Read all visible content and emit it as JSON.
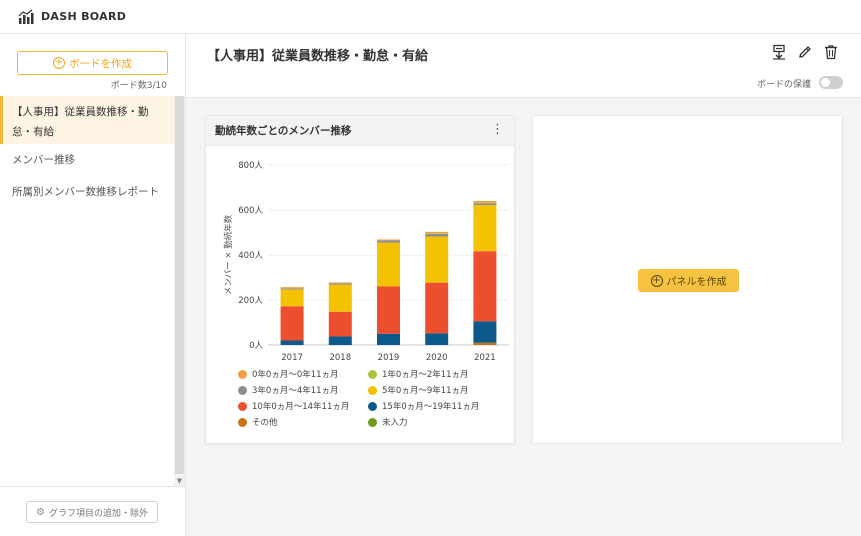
{
  "app": {
    "title": "DASH BOARD",
    "logo_icon": "bar-chart-icon"
  },
  "sidebar": {
    "create_board_label": "ボードを作成",
    "board_count": "ボード数3/10",
    "items": [
      {
        "label": "【人事用】従業員数推移・勤怠・有給",
        "active": true
      },
      {
        "label": "メンバー推移",
        "active": false
      },
      {
        "label": "所属別メンバー数推移レポート",
        "active": false
      }
    ],
    "graph_items_button": "グラフ項目の追加・除外"
  },
  "header": {
    "title": "【人事用】従業員数推移・勤怠・有給",
    "protect_label": "ボードの保護",
    "protect_on": false,
    "icons": [
      "export-icon",
      "edit-icon",
      "trash-icon"
    ]
  },
  "panel": {
    "title": "勤続年数ごとのメンバー推移",
    "menu_icon": "kebab-menu-icon"
  },
  "chart_data": {
    "type": "bar",
    "stacked": true,
    "title": "",
    "ylabel": "メンバー × 勤続年数",
    "xlabel": "",
    "categories": [
      "2017",
      "2018",
      "2019",
      "2020",
      "2021"
    ],
    "yticks": [
      "0人",
      "200人",
      "400人",
      "600人",
      "800人"
    ],
    "ylim": [
      0,
      800
    ],
    "grid": true,
    "series": [
      {
        "name": "未入力",
        "color": "#6f9a1e",
        "values": [
          0,
          0,
          0,
          0,
          0
        ]
      },
      {
        "name": "その他",
        "color": "#c87410",
        "values": [
          0,
          0,
          0,
          0,
          10
        ]
      },
      {
        "name": "15年0ヵ月〜19年11ヵ月",
        "color": "#0d5a8a",
        "values": [
          20,
          38,
          50,
          52,
          95
        ]
      },
      {
        "name": "10年0ヵ月〜14年11ヵ月",
        "color": "#ec4f2f",
        "values": [
          152,
          110,
          210,
          225,
          312
        ]
      },
      {
        "name": "5年0ヵ月〜9年11ヵ月",
        "color": "#f2c203",
        "values": [
          75,
          120,
          195,
          205,
          205
        ]
      },
      {
        "name": "3年0ヵ月〜4年11ヵ月",
        "color": "#8f8f8f",
        "values": [
          5,
          6,
          10,
          12,
          8
        ]
      },
      {
        "name": "1年0ヵ月〜2年11ヵ月",
        "color": "#a7c43c",
        "values": [
          0,
          0,
          0,
          3,
          2
        ]
      },
      {
        "name": "0年0ヵ月〜0年11ヵ月",
        "color": "#f0a040",
        "values": [
          5,
          4,
          4,
          6,
          8
        ]
      }
    ],
    "legend_placement": "bottom"
  },
  "legend_items": [
    {
      "label": "0年0ヵ月〜0年11ヵ月",
      "color": "#f0a040"
    },
    {
      "label": "1年0ヵ月〜2年11ヵ月",
      "color": "#a7c43c"
    },
    {
      "label": "3年0ヵ月〜4年11ヵ月",
      "color": "#8f8f8f"
    },
    {
      "label": "5年0ヵ月〜9年11ヵ月",
      "color": "#f2c203"
    },
    {
      "label": "10年0ヵ月〜14年11ヵ月",
      "color": "#ec4f2f"
    },
    {
      "label": "15年0ヵ月〜19年11ヵ月",
      "color": "#0d5a8a"
    },
    {
      "label": "その他",
      "color": "#c87410"
    },
    {
      "label": "未入力",
      "color": "#6f9a1e"
    }
  ],
  "empty_panel": {
    "create_panel_label": "パネルを作成"
  }
}
